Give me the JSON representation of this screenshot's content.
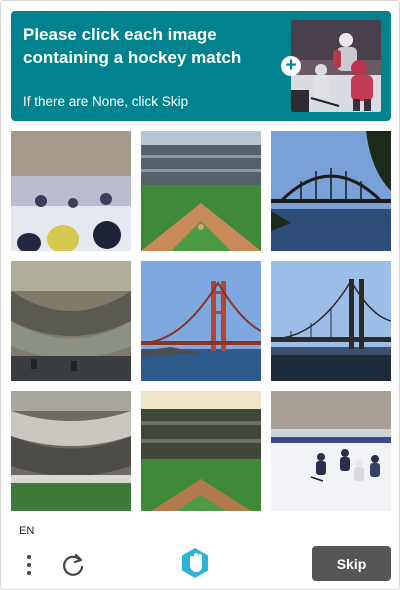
{
  "challenge": {
    "prompt": "Please click each image containing a hockey match",
    "hint": "If there are None, click Skip"
  },
  "example_image": {
    "subject": "hockey-players",
    "alt": "example hockey match"
  },
  "tiles": [
    {
      "subject": "hockey-crowd-blurred"
    },
    {
      "subject": "baseball-stadium"
    },
    {
      "subject": "arch-bridge"
    },
    {
      "subject": "stadium-blurred"
    },
    {
      "subject": "golden-gate-bridge"
    },
    {
      "subject": "suspension-bridge"
    },
    {
      "subject": "stadium-blurred-2"
    },
    {
      "subject": "baseball-stadium-2"
    },
    {
      "subject": "hockey-match"
    }
  ],
  "footer": {
    "language": "EN",
    "skip_label": "Skip"
  },
  "colors": {
    "accent": "#00838f",
    "skip_button": "#555555"
  }
}
